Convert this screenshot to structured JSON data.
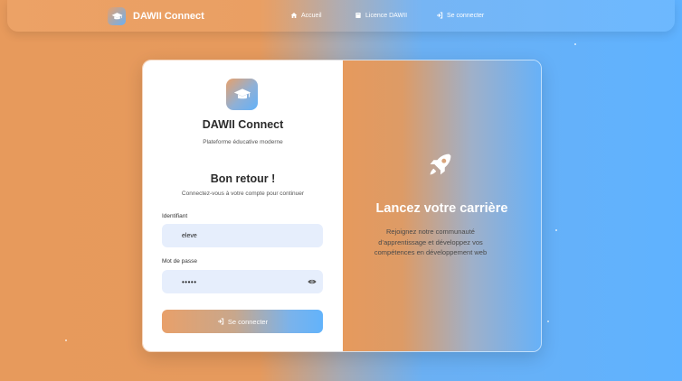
{
  "navbar": {
    "brand": "DAWII Connect",
    "links": [
      {
        "label": "Accueil",
        "icon": "home-icon"
      },
      {
        "label": "Licence DAWII",
        "icon": "book-icon"
      },
      {
        "label": "Se connecter",
        "icon": "sign-in-icon"
      }
    ]
  },
  "login": {
    "app_title": "DAWII Connect",
    "app_subtitle": "Plateforme éducative moderne",
    "heading": "Bon retour !",
    "subheading": "Connectez-vous à votre compte pour continuer",
    "username_label": "Identifiant",
    "username_value": "eleve",
    "password_label": "Mot de passe",
    "password_value": "•••••",
    "submit_label": "Se connecter"
  },
  "promo": {
    "title": "Lancez votre carrière",
    "text": "Rejoignez notre communauté d’apprentissage et développez vos compétences en développement web"
  },
  "colors": {
    "orange": "#e79a5c",
    "blue": "#5fb2ff"
  }
}
